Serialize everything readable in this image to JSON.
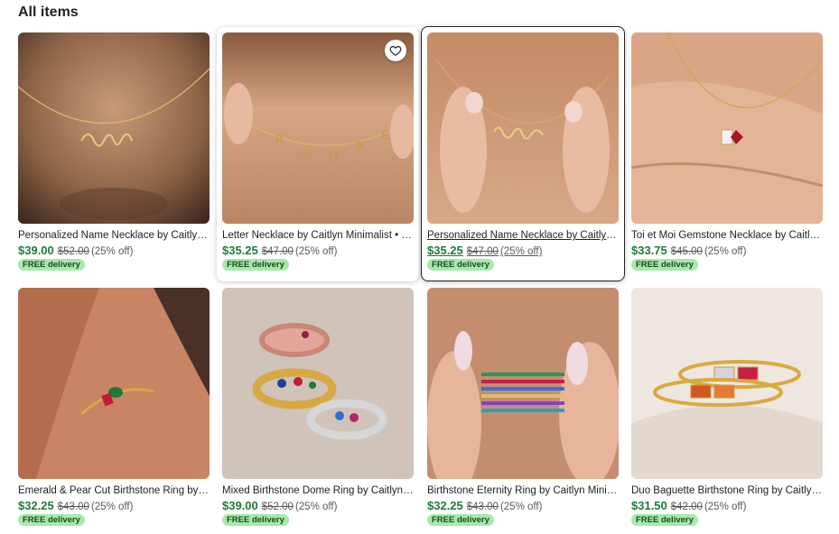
{
  "section": {
    "title": "All items"
  },
  "colors": {
    "price": "#1e7a3c",
    "badge_bg": "#a7e8ab",
    "badge_text": "#1a4a1f"
  },
  "items": [
    {
      "title": "Personalized Name Necklace by Caitlyn Minimalist",
      "price": "$39.00",
      "original_price": "$52.00",
      "discount": "(25% off)",
      "badge": "FREE delivery",
      "image_icon": "name-necklace-image"
    },
    {
      "title": "Letter Necklace by Caitlyn Minimalist • Personalized Initial Necklace",
      "price": "$35.25",
      "original_price": "$47.00",
      "discount": "(25% off)",
      "badge": "FREE delivery",
      "image_icon": "letter-necklace-image"
    },
    {
      "title": "Personalized Name Necklace by Caitlyn Minimalist",
      "price": "$35.25",
      "original_price": "$47.00",
      "discount": "(25% off)",
      "badge": "FREE delivery",
      "image_icon": "name-necklace-image"
    },
    {
      "title": "Toi et Moi Gemstone Necklace by Caitlyn Minimalist",
      "price": "$33.75",
      "original_price": "$45.00",
      "discount": "(25% off)",
      "badge": "FREE delivery",
      "image_icon": "gemstone-necklace-image"
    },
    {
      "title": "Emerald & Pear Cut Birthstone Ring by Caitlyn Minimalist",
      "price": "$32.25",
      "original_price": "$43.00",
      "discount": "(25% off)",
      "badge": "FREE delivery",
      "image_icon": "birthstone-ring-image"
    },
    {
      "title": "Mixed Birthstone Dome Ring by Caitlyn Minimalist",
      "price": "$39.00",
      "original_price": "$52.00",
      "discount": "(25% off)",
      "badge": "FREE delivery",
      "image_icon": "dome-ring-image"
    },
    {
      "title": "Birthstone Eternity Ring by Caitlyn Minimalist",
      "price": "$32.25",
      "original_price": "$43.00",
      "discount": "(25% off)",
      "badge": "FREE delivery",
      "image_icon": "eternity-ring-image"
    },
    {
      "title": "Duo Baguette Birthstone Ring by Caitlyn Minimalist",
      "price": "$31.50",
      "original_price": "$42.00",
      "discount": "(25% off)",
      "badge": "FREE delivery",
      "image_icon": "baguette-ring-image"
    }
  ],
  "favorite": {
    "icon": "heart-icon"
  }
}
